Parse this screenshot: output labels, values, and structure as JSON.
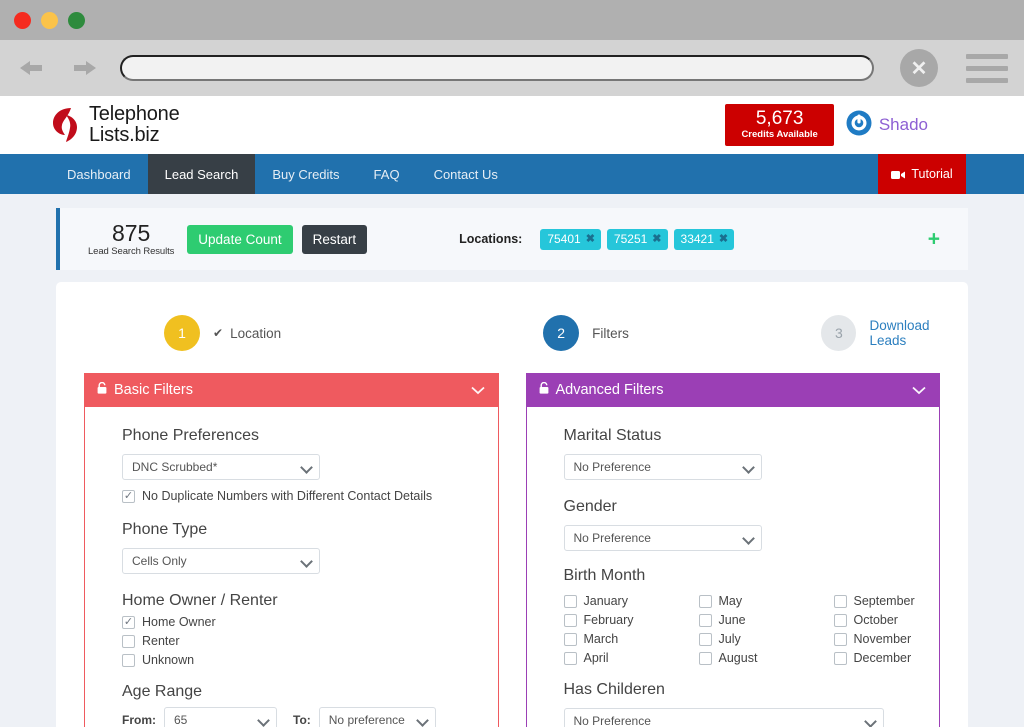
{
  "browser": {
    "back_icon": "back-arrow-icon",
    "forward_icon": "forward-arrow-icon",
    "url_value": "",
    "url_placeholder": "",
    "close_label": "✕",
    "menu_icon": "hamburger-menu-icon"
  },
  "header": {
    "brand_line1": "Telephone",
    "brand_line2": "Lists.biz",
    "credits_number": "5,673",
    "credits_label": "Credits Available",
    "account_name": "Shado",
    "accent_red": "#cc0000",
    "accent_purple": "#8d5fd3"
  },
  "nav": {
    "items": [
      {
        "label": "Dashboard",
        "active": false
      },
      {
        "label": "Lead Search",
        "active": true
      },
      {
        "label": "Buy Credits",
        "active": false
      },
      {
        "label": "FAQ",
        "active": false
      },
      {
        "label": "Contact Us",
        "active": false
      }
    ],
    "tutorial_label": "Tutorial",
    "bar_color": "#2171ad",
    "active_color": "#373f46"
  },
  "results": {
    "count": "875",
    "count_label": "Lead Search Results",
    "update_button": "Update Count",
    "restart_button": "Restart",
    "locations_label": "Locations:",
    "location_tags": [
      "75401",
      "75251",
      "33421"
    ],
    "tag_remove_glyph": "✖",
    "add_location_glyph": "+"
  },
  "steps": [
    {
      "number": "1",
      "label": "Location",
      "check": "✔",
      "state": "complete"
    },
    {
      "number": "2",
      "label": "Filters",
      "check": "",
      "state": "active"
    },
    {
      "number": "3",
      "label": "Download Leads",
      "check": "",
      "state": "pending"
    }
  ],
  "basic_filters": {
    "title": "Basic Filters",
    "lock_icon": "lock-icon",
    "collapse_icon": "chevron-down-icon",
    "header_color": "#ef5a5f",
    "phone_preferences": {
      "label": "Phone Preferences",
      "value": "DNC Scrubbed*",
      "options": [
        "DNC Scrubbed*"
      ]
    },
    "no_duplicates": {
      "label": "No Duplicate Numbers with Different Contact Details",
      "checked": true
    },
    "phone_type": {
      "label": "Phone Type",
      "value": "Cells Only",
      "options": [
        "Cells Only"
      ]
    },
    "home_owner": {
      "label": "Home Owner / Renter",
      "options": [
        {
          "label": "Home Owner",
          "checked": true
        },
        {
          "label": "Renter",
          "checked": false
        },
        {
          "label": "Unknown",
          "checked": false
        }
      ]
    },
    "age_range": {
      "label": "Age Range",
      "from_label": "From:",
      "from_value": "65",
      "to_label": "To:",
      "to_value": "No preference"
    }
  },
  "advanced_filters": {
    "title": "Advanced Filters",
    "lock_icon": "lock-icon",
    "collapse_icon": "chevron-down-icon",
    "header_color": "#9b3fb5",
    "marital_status": {
      "label": "Marital Status",
      "value": "No Preference",
      "options": [
        "No Preference"
      ]
    },
    "gender": {
      "label": "Gender",
      "value": "No Preference",
      "options": [
        "No Preference"
      ]
    },
    "birth_month": {
      "label": "Birth Month",
      "columns": [
        [
          {
            "label": "January",
            "checked": false
          },
          {
            "label": "February",
            "checked": false
          },
          {
            "label": "March",
            "checked": false
          },
          {
            "label": "April",
            "checked": false
          }
        ],
        [
          {
            "label": "May",
            "checked": false
          },
          {
            "label": "June",
            "checked": false
          },
          {
            "label": "July",
            "checked": false
          },
          {
            "label": "August",
            "checked": false
          }
        ],
        [
          {
            "label": "September",
            "checked": false
          },
          {
            "label": "October",
            "checked": false
          },
          {
            "label": "November",
            "checked": false
          },
          {
            "label": "December",
            "checked": false
          }
        ]
      ]
    },
    "has_children": {
      "label": "Has Childeren",
      "value": "No Preference",
      "options": [
        "No Preference"
      ]
    }
  }
}
